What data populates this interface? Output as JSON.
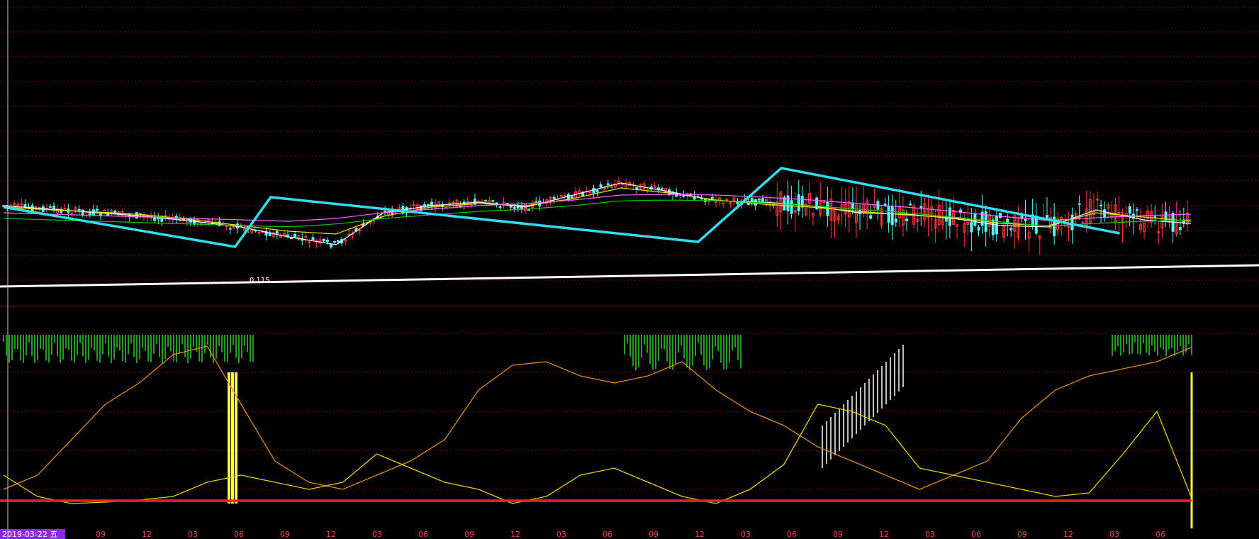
{
  "chart_data": [
    {
      "type": "line",
      "panel": "price",
      "title": "",
      "xlabel": "",
      "ylabel": "",
      "grid": true,
      "legend": "none",
      "annotations": [
        "0.115"
      ],
      "colors": {
        "background": "#000000",
        "grid": "#8b0000",
        "candle_up": "#ff3b3b",
        "candle_down": "#54ffff",
        "trend_lines": "#33ddee",
        "support_line": "#ffffff",
        "ma_short": "#ffffff",
        "ma_mid": "#e6e600",
        "ma_long": "#ff66ff",
        "ma_longest": "#00cc00"
      },
      "x": [
        0,
        4,
        8,
        12,
        16,
        20,
        24,
        28,
        32,
        36,
        40,
        44,
        48,
        52,
        56,
        60,
        64,
        68,
        72,
        76,
        80,
        84,
        88,
        92,
        96,
        100
      ],
      "series": [
        {
          "values": [
            290,
            295,
            300,
            305,
            312,
            320,
            334,
            345,
            300,
            290,
            285,
            292,
            275,
            258,
            270,
            283,
            285,
            290,
            300,
            302,
            308,
            318,
            320,
            296,
            310,
            315
          ]
        },
        {
          "values": [
            292,
            296,
            299,
            303,
            310,
            318,
            326,
            330,
            305,
            292,
            287,
            290,
            280,
            265,
            272,
            282,
            288,
            292,
            298,
            303,
            307,
            315,
            318,
            300,
            306,
            312
          ]
        },
        {
          "values": [
            300,
            302,
            304,
            306,
            308,
            310,
            312,
            308,
            300,
            295,
            290,
            287,
            282,
            275,
            274,
            275,
            278,
            282,
            287,
            292,
            298,
            305,
            311,
            307,
            304,
            302
          ]
        }
      ],
      "trend_polyline": [
        {
          "x": 0,
          "y": 292
        },
        {
          "x": 19.5,
          "y": 348
        },
        {
          "x": 22.5,
          "y": 278
        },
        {
          "x": 58.5,
          "y": 341
        },
        {
          "x": 65.5,
          "y": 237
        },
        {
          "x": 94,
          "y": 329
        }
      ]
    },
    {
      "type": "bar",
      "panel": "indicator",
      "title": "",
      "xlabel": "",
      "ylabel": "",
      "grid": true,
      "legend": "none",
      "threshold_line": {
        "value": 622,
        "color": "#ff2020"
      },
      "colors": {
        "green_bars": "#33cc33",
        "yellow_bars": "#ffff33",
        "white_bars": "#ffffff",
        "orange_line": "#e08a10",
        "yellow_line": "#e6d000"
      },
      "series": [
        {
          "values": [
            620,
            600,
            550,
            500,
            470,
            430,
            418,
            500,
            580,
            610,
            620,
            600,
            580,
            550,
            480,
            445,
            440,
            460,
            470,
            460,
            440,
            480,
            510,
            530,
            560,
            580,
            600,
            620,
            600,
            580,
            520,
            480,
            460,
            450,
            440,
            420
          ]
        },
        {
          "values": [
            590,
            620,
            630,
            628,
            625,
            620,
            600,
            590,
            600,
            610,
            600,
            560,
            580,
            600,
            610,
            630,
            620,
            590,
            580,
            600,
            620,
            630,
            610,
            575,
            490,
            500,
            520,
            580,
            590,
            600,
            610,
            620,
            615,
            560,
            500,
            620
          ]
        }
      ]
    }
  ],
  "x_axis": {
    "cursor_date_label": "2019-03-22 五",
    "tick_labels": [
      "09",
      "12",
      "03",
      "06",
      "09",
      "12",
      "03",
      "06",
      "09",
      "12",
      "03",
      "06",
      "09",
      "12",
      "03",
      "06",
      "09",
      "12",
      "03",
      "06",
      "09",
      "12",
      "03",
      "06"
    ]
  }
}
